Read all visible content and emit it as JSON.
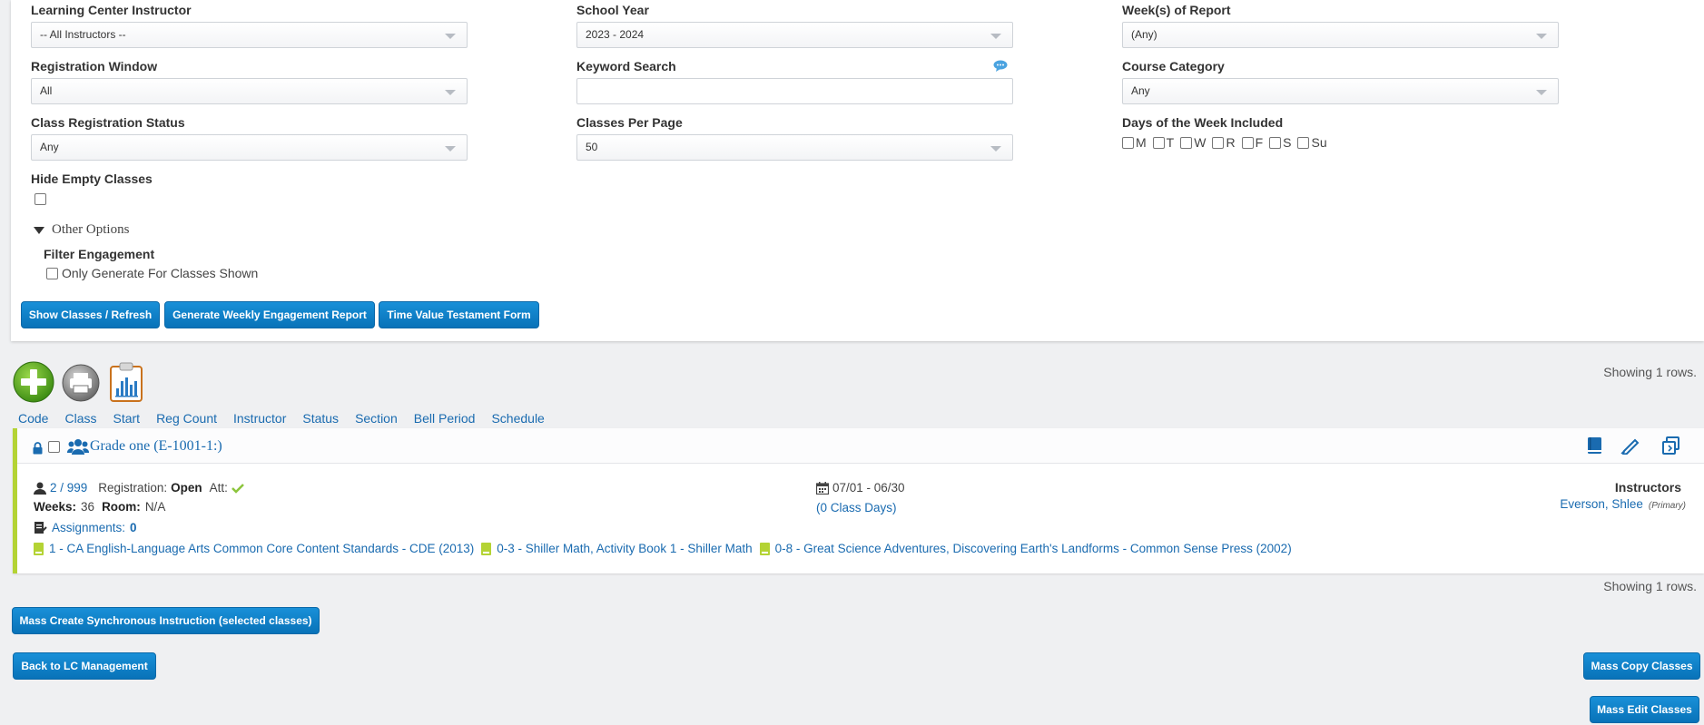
{
  "filters": {
    "instructor": {
      "label": "Learning Center Instructor",
      "value": "-- All Instructors --"
    },
    "school_year": {
      "label": "School Year",
      "value": "2023 - 2024"
    },
    "weeks": {
      "label": "Week(s) of Report",
      "value": "(Any)"
    },
    "registration_window": {
      "label": "Registration Window",
      "value": "All"
    },
    "keyword": {
      "label": "Keyword Search",
      "value": "",
      "placeholder": ""
    },
    "course_category": {
      "label": "Course Category",
      "value": "Any"
    },
    "reg_status": {
      "label": "Class Registration Status",
      "value": "Any"
    },
    "per_page": {
      "label": "Classes Per Page",
      "value": "50"
    },
    "days": {
      "label": "Days of the Week Included",
      "items": [
        "M",
        "T",
        "W",
        "R",
        "F",
        "S",
        "Su"
      ]
    },
    "hide_empty": {
      "label": "Hide Empty Classes"
    },
    "other_options": "Other Options",
    "filter_engagement": {
      "label": "Filter Engagement",
      "checkbox_label": "Only Generate For Classes Shown"
    }
  },
  "buttons": {
    "show_classes": "Show Classes / Refresh",
    "weekly_report": "Generate Weekly Engagement Report",
    "time_value": "Time Value Testament Form",
    "mass_sync": "Mass Create Synchronous Instruction (selected classes)",
    "back_lc": "Back to LC Management",
    "mass_copy": "Mass Copy Classes",
    "mass_edit": "Mass Edit Classes"
  },
  "showing_text": "Showing 1 rows.",
  "sort_columns": [
    "Code",
    "Class",
    "Start",
    "Reg Count",
    "Instructor",
    "Status",
    "Section",
    "Bell Period",
    "Schedule"
  ],
  "class_card": {
    "title": "Grade one (E-1001-1:)",
    "enrollment": "2 / 999",
    "registration_label": "Registration:",
    "registration_value": "Open",
    "att_label": "Att:",
    "weeks_label": "Weeks:",
    "weeks_value": "36",
    "room_label": "Room:",
    "room_value": "N/A",
    "assignments_label": "Assignments:",
    "assignments_value": "0",
    "date_range": "07/01 - 06/30",
    "class_days": "(0 Class Days)",
    "instructors_label": "Instructors",
    "instructor_name": "Everson, Shlee",
    "instructor_role": "(Primary)",
    "curricula": [
      "1 - CA English-Language Arts Common Core Content Standards - CDE (2013)",
      "0-3 - Shiller Math, Activity Book 1 - Shiller Math",
      "0-8 - Great Science Adventures, Discovering Earth's Landforms - Common Sense Press (2002)"
    ]
  },
  "colors": {
    "link": "#1a6bb0",
    "button": "#0a7dc6",
    "accent_green": "#b4d334"
  }
}
